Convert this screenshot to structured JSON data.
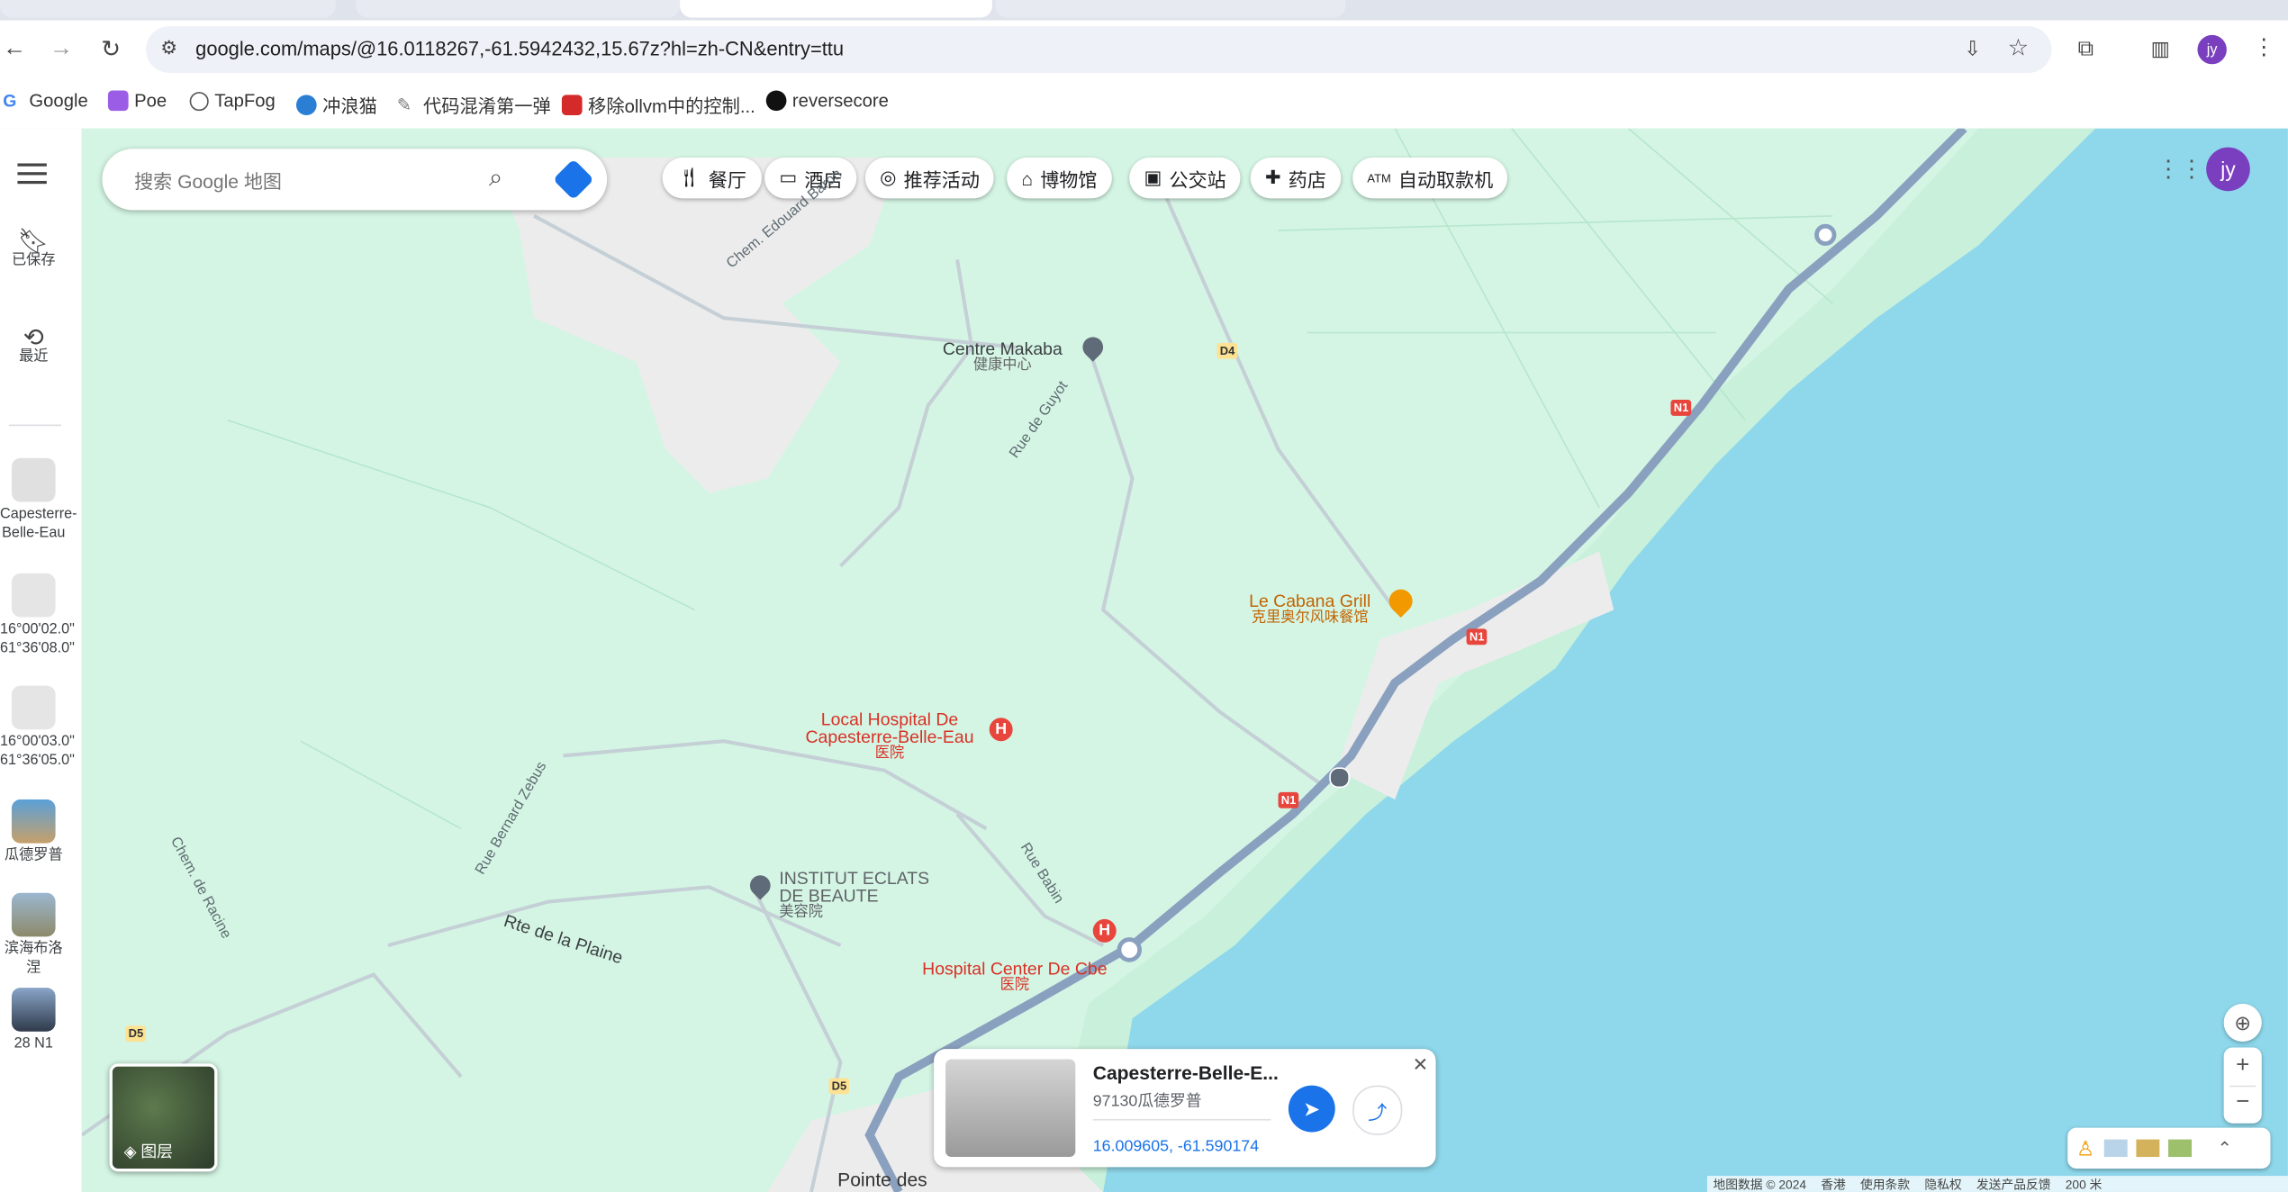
{
  "browser": {
    "url": "google.com/maps/@16.0118267,-61.5942432,15.67z?hl=zh-CN&entry=ttu",
    "profile_initials": "jy",
    "bookmarks": [
      {
        "label": "Google",
        "color": "#4285f4"
      },
      {
        "label": "Poe",
        "color": "#9b5de5"
      },
      {
        "label": "TapFog",
        "color": "#555555"
      },
      {
        "label": "冲浪猫",
        "color": "#2a7fd4"
      },
      {
        "label": "代码混淆第一弹",
        "color": "#777777"
      },
      {
        "label": "移除ollvm中的控制...",
        "color": "#d42a2a"
      },
      {
        "label": "reversecore",
        "color": "#111111"
      }
    ]
  },
  "rail": {
    "menu_icon": "hamburger-icon",
    "saved_label": "已保存",
    "recent_label": "最近",
    "recent_items": [
      {
        "label_line1": "Capesterre-",
        "label_line2": "Belle-Eau"
      },
      {
        "label_line1": "16°00'02.0\"",
        "label_line2": "61°36'08.0\""
      },
      {
        "label_line1": "16°00'03.0\"",
        "label_line2": "61°36'05.0\""
      },
      {
        "label_line1": "瓜德罗普",
        "label_line2": ""
      },
      {
        "label_line1": "滨海布洛涅",
        "label_line2": ""
      },
      {
        "label_line1": "28 N1",
        "label_line2": ""
      }
    ]
  },
  "search": {
    "placeholder": "搜索 Google 地图"
  },
  "chips": [
    {
      "label": "餐厅",
      "icon": "fork-knife-icon"
    },
    {
      "label": "酒店",
      "icon": "bed-icon"
    },
    {
      "label": "推荐活动",
      "icon": "camera-icon"
    },
    {
      "label": "博物馆",
      "icon": "museum-icon"
    },
    {
      "label": "公交站",
      "icon": "bus-icon"
    },
    {
      "label": "药店",
      "icon": "pharmacy-icon"
    },
    {
      "label": "自动取款机",
      "icon": "atm-icon"
    }
  ],
  "map": {
    "places": {
      "centre_makaba": {
        "name": "Centre Makaba",
        "sub": "健康中心"
      },
      "le_cabana": {
        "name": "Le Cabana Grill",
        "sub": "克里奥尔风味餐馆"
      },
      "local_hospital": {
        "name1": "Local Hospital De",
        "name2": "Capesterre-Belle-Eau",
        "sub": "医院"
      },
      "institut": {
        "name1": "INSTITUT ECLATS",
        "name2": "DE BEAUTE",
        "sub": "美容院"
      },
      "hospital_center": {
        "name": "Hospital Center De Cbe",
        "sub": "医院"
      },
      "pointe": {
        "name": "Pointe des"
      }
    },
    "roads": {
      "edouard": "Chem. Edouard Baron",
      "guyot": "Rue de Guyot",
      "bernard": "Rue Bernard Zebus",
      "racine": "Chem. de Racine",
      "plaine": "Rte de la Plaine",
      "babin": "Rue Babin"
    },
    "shields": {
      "d4": "D4",
      "d5": "D5",
      "n1": "N1"
    },
    "layers_label": "图层"
  },
  "place_card": {
    "title": "Capesterre-Belle-E...",
    "address": "97130瓜德罗普",
    "coords": "16.009605, -61.590174"
  },
  "footer": {
    "items": [
      "地图数据 © 2024",
      "香港",
      "使用条款",
      "隐私权",
      "发送产品反馈",
      "200 米"
    ]
  },
  "colors": {
    "land": "#d4f5e4",
    "water": "#8fd8ec",
    "highway": "#8aa0bf",
    "red_poi": "#e8453c",
    "orange_poi": "#f29900",
    "blue": "#1a73e8"
  }
}
